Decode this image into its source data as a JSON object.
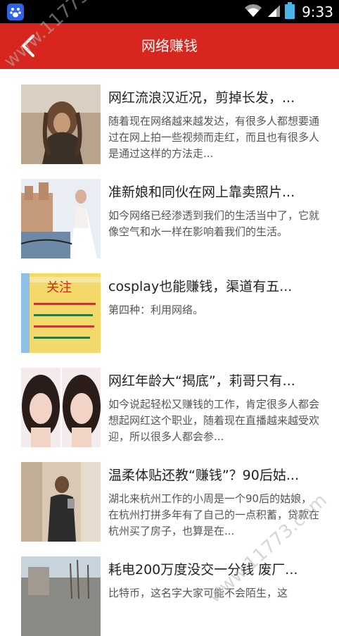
{
  "status_bar": {
    "time": "9:33",
    "app_icon": "baidu-paw-icon",
    "icons": [
      "wifi-icon",
      "signal-icon",
      "battery-icon"
    ]
  },
  "header": {
    "title": "网络赚钱",
    "back_icon": "back-arrow-icon"
  },
  "articles": [
    {
      "title": "网红流浪汉近况，剪掉长发，...",
      "desc": "随着现在网络越来越发达，有很多人都想要通过在网上拍一些视频而走红，而且也有很多人是通过这样的方法走..."
    },
    {
      "title": "准新娘和同伙在网上靠卖照片...",
      "desc": "如今网络已经渗透到我们的生活当中了，它就像空气和水一样在影响着我们的生活。"
    },
    {
      "title": "cosplay也能赚钱，渠道有五...",
      "desc": "第四种：利用网络。",
      "thumb_text": "关注"
    },
    {
      "title": "网红年龄大“揭底”，莉哥只有...",
      "desc": "如今说起轻松又赚钱的工作，肯定很多人都会想起网红这个职业，随着现在直播越来越受欢迎，所以很多人都会参..."
    },
    {
      "title": "温柔体贴还教“赚钱”？90后姑...",
      "desc": "湖北来杭州工作的小周是一个90后的姑娘，在杭州打拼多年有了自己的一点积蓄，贷款在杭州买了房子，也算是在..."
    },
    {
      "title": "耗电200万度没交一分钱 废厂...",
      "desc": "比特币，这名字大家可能不会陌生，这"
    }
  ],
  "watermark": "www.11773.com",
  "colors": {
    "header_red": "#d6261e",
    "status_black": "#000000"
  }
}
